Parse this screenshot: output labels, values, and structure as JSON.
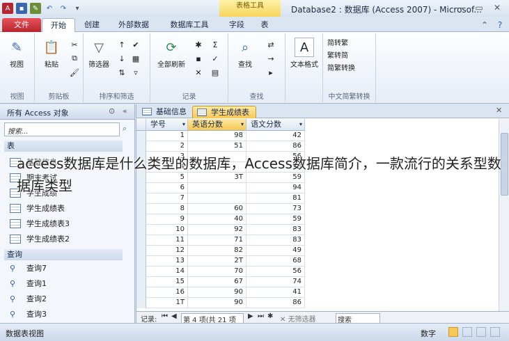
{
  "window": {
    "title": "Database2 : 数据库 (Access 2007) - Microsof...",
    "context_tool": "表格工具"
  },
  "tabs": [
    {
      "label": "文件"
    },
    {
      "label": "开始"
    },
    {
      "label": "创建"
    },
    {
      "label": "外部数据"
    },
    {
      "label": "数据库工具"
    },
    {
      "label": "字段"
    },
    {
      "label": "表"
    }
  ],
  "ribbon": {
    "groups": [
      "视图",
      "剪贴板",
      "排序和筛选",
      "记录",
      "查找",
      "",
      "中文简繁转换"
    ],
    "buttons": {
      "view": "视图",
      "paste": "粘贴",
      "filter": "筛选器",
      "refresh": "全部刷新",
      "find": "查找",
      "textformat": "文本格式"
    },
    "conv": [
      "简转繁",
      "繁转简",
      "简繁转换"
    ]
  },
  "nav": {
    "title": "所有 Access 对象",
    "search_placeholder": "搜索...",
    "section_tables": "表",
    "tables": [
      "基础信息",
      "期末考试",
      "学生成绩",
      "学生成绩表",
      "学生成绩表3",
      "学生成绩表2"
    ],
    "section_queries": "查询",
    "queries": [
      "查询7",
      "查询1",
      "查询2",
      "查询3"
    ]
  },
  "doc_tabs": [
    "基础信息",
    "学生成绩表"
  ],
  "grid": {
    "columns": [
      "学号",
      "英语分数",
      "语文分数"
    ],
    "rows": [
      [
        "1",
        "98",
        "42"
      ],
      [
        "2",
        "51",
        "86"
      ],
      [
        "3",
        "",
        "56"
      ],
      [
        "4",
        "",
        "93"
      ],
      [
        "5",
        "3T",
        "59"
      ],
      [
        "6",
        "",
        "94"
      ],
      [
        "7",
        "",
        "81"
      ],
      [
        "8",
        "60",
        "73"
      ],
      [
        "9",
        "40",
        "59"
      ],
      [
        "10",
        "92",
        "83"
      ],
      [
        "11",
        "71",
        "83"
      ],
      [
        "12",
        "82",
        "49"
      ],
      [
        "13",
        "2T",
        "68"
      ],
      [
        "14",
        "70",
        "56"
      ],
      [
        "15",
        "67",
        "74"
      ],
      [
        "16",
        "90",
        "41"
      ],
      [
        "1T",
        "90",
        "86"
      ]
    ]
  },
  "record_nav": {
    "label": "记录:",
    "position": "第 4 项(共 21 项",
    "filter": "无筛选器",
    "search": "搜索"
  },
  "status": {
    "left": "数据表视图",
    "right": "数字"
  },
  "caption": "access数据库是什么类型的数据库，Access数据库简介，一款流行的关系型数据库类型",
  "colors": {
    "file_tab": "#c1323a",
    "active_doc_tab": "#f7c857",
    "ribbon_bg": "#e6edf6"
  }
}
